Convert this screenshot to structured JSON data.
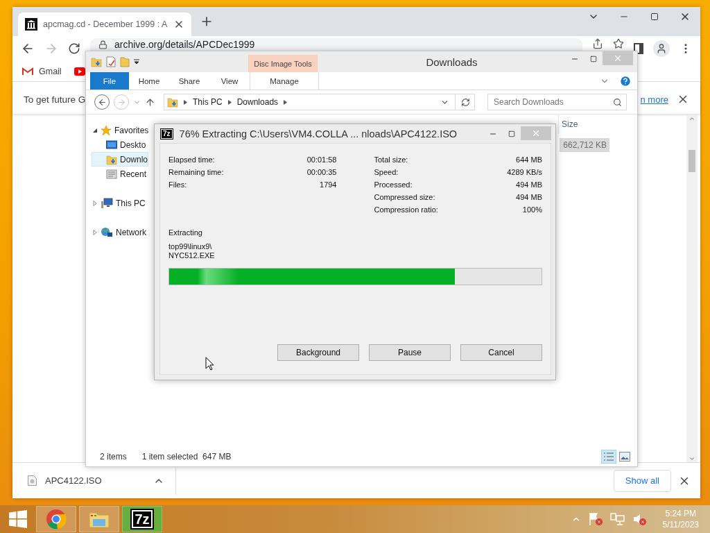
{
  "browser": {
    "tab_title": "apcmag.cd - December 1999 : A",
    "address": "archive.org/details/APCDec1999",
    "bookmarks": [
      {
        "label": "Gmail",
        "kind": "gmail"
      },
      {
        "kind": "youtube"
      }
    ],
    "info_bar": {
      "text": "To get future G",
      "link": "n more"
    },
    "download": {
      "filename": "APC4122.ISO"
    },
    "show_all": "Show all"
  },
  "explorer": {
    "title": "Downloads",
    "context_group": "Disc Image Tools",
    "ribbon_tabs": [
      {
        "label": "File",
        "kind": "file",
        "selected": false
      },
      {
        "label": "Home",
        "kind": "tab",
        "selected": false
      },
      {
        "label": "Share",
        "kind": "tab",
        "selected": false
      },
      {
        "label": "View",
        "kind": "tab",
        "selected": false
      },
      {
        "label": "Manage",
        "kind": "context",
        "selected": false
      }
    ],
    "breadcrumb": [
      "This PC",
      "Downloads"
    ],
    "search": {
      "placeholder": "Search Downloads"
    },
    "nav": [
      {
        "label": "Favorites",
        "kind": "star",
        "expanded": true,
        "children": [
          {
            "label": "Deskto",
            "kind": "desktop",
            "selected": false
          },
          {
            "label": "Downlo",
            "kind": "downloads",
            "selected": true
          },
          {
            "label": "Recent",
            "kind": "recent",
            "selected": false
          }
        ]
      },
      {
        "label": "This PC",
        "kind": "pc",
        "expanded": false
      },
      {
        "label": "Network",
        "kind": "network",
        "expanded": false
      }
    ],
    "columns": [
      "Size"
    ],
    "rows": [
      {
        "size": "662,712 KB",
        "selected": true
      }
    ],
    "status": [
      "2 items",
      "1 item selected  647 MB"
    ]
  },
  "dialog": {
    "icon_text": "7z",
    "title": "76% Extracting C:\\Users\\VM4.COLLA ... nloads\\APC4122.ISO",
    "stats_left": [
      {
        "label": "Elapsed time:",
        "value": "00:01:58"
      },
      {
        "label": "Remaining time:",
        "value": "00:00:35"
      },
      {
        "label": "Files:",
        "value": "1794"
      }
    ],
    "stats_right": [
      {
        "label": "Total size:",
        "value": "644 MB"
      },
      {
        "label": "Speed:",
        "value": "4289 KB/s"
      },
      {
        "label": "Processed:",
        "value": "494 MB"
      },
      {
        "label": "Compressed size:",
        "value": "494 MB"
      },
      {
        "label": "Compression ratio:",
        "value": "100%"
      }
    ],
    "action": "Extracting",
    "current_file": [
      "top99\\linux9\\",
      "NYC512.EXE"
    ],
    "progress": {
      "level": 0.767
    },
    "buttons": [
      "Background",
      "Pause",
      "Cancel"
    ]
  },
  "taskbar": {
    "apps": [
      {
        "kind": "chrome",
        "active": false
      },
      {
        "kind": "explorer",
        "active": false
      },
      {
        "kind": "sevenzip",
        "label": "7z",
        "active": true
      }
    ],
    "time": "5:24 PM",
    "date": "5/11/2023"
  }
}
